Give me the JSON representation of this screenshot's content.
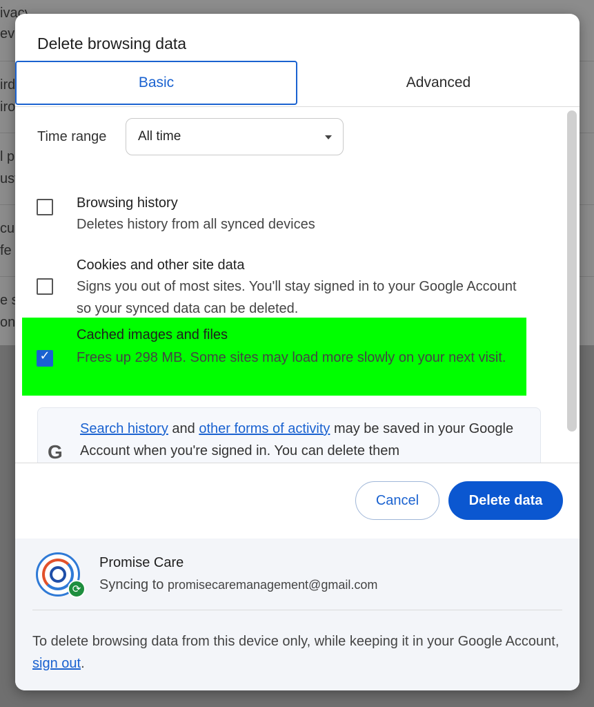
{
  "background": {
    "rows": [
      "ivacy Guide",
      "evi",
      "ird",
      "iro",
      "l p",
      "ust",
      "cu",
      "fe",
      "e s",
      "ont"
    ]
  },
  "dialog": {
    "title": "Delete browsing data",
    "tabs": [
      {
        "label": "Basic",
        "selected": true
      },
      {
        "label": "Advanced",
        "selected": false
      }
    ],
    "time_range": {
      "label": "Time range",
      "value": "All time"
    },
    "options": [
      {
        "title": "Browsing history",
        "description": "Deletes history from all synced devices",
        "checked": false
      },
      {
        "title": "Cookies and other site data",
        "description": "Signs you out of most sites. You'll stay signed in to your Google Account so your synced data can be deleted.",
        "checked": false
      },
      {
        "title": "Cached images and files",
        "description": "Frees up 298 MB. Some sites may load more slowly on your next visit.",
        "checked": true
      }
    ],
    "info": {
      "link1": "Search history",
      "text1": " and ",
      "link2": "other forms of activity",
      "text2": " may be saved in your Google Account when you're signed in. You can delete them"
    },
    "buttons": {
      "cancel": "Cancel",
      "delete": "Delete data"
    },
    "account": {
      "name": "Promise Care",
      "sync_prefix": "Syncing to ",
      "email": "promisecaremanagement@gmail.com"
    },
    "footer_note": {
      "text": "To delete browsing data from this device only, while keeping it in your Google Account, ",
      "link": "sign out",
      "suffix": "."
    },
    "colors": {
      "accent": "#0b57d0",
      "highlight": "#00ff00"
    }
  }
}
